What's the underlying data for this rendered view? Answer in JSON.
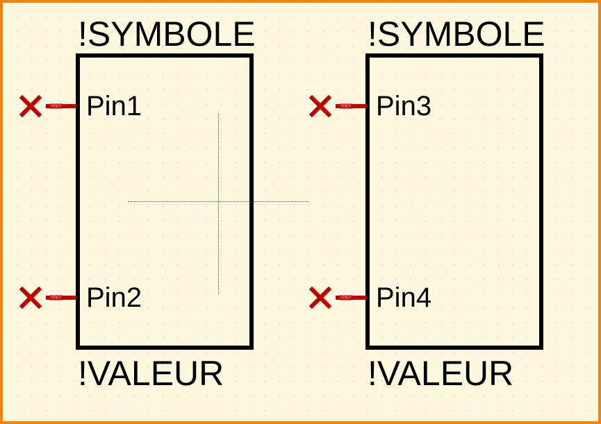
{
  "components": {
    "left": {
      "name_label": "!SYMBOLE",
      "value_label": "!VALEUR",
      "pins": [
        {
          "label": "Pin1",
          "nc_text": "<nc>"
        },
        {
          "label": "Pin2",
          "nc_text": "<nc>"
        }
      ]
    },
    "right": {
      "name_label": "!SYMBOLE",
      "value_label": "!VALEUR",
      "pins": [
        {
          "label": "Pin3",
          "nc_text": "<nc>"
        },
        {
          "label": "Pin4",
          "nc_text": "<nc>"
        }
      ]
    }
  }
}
